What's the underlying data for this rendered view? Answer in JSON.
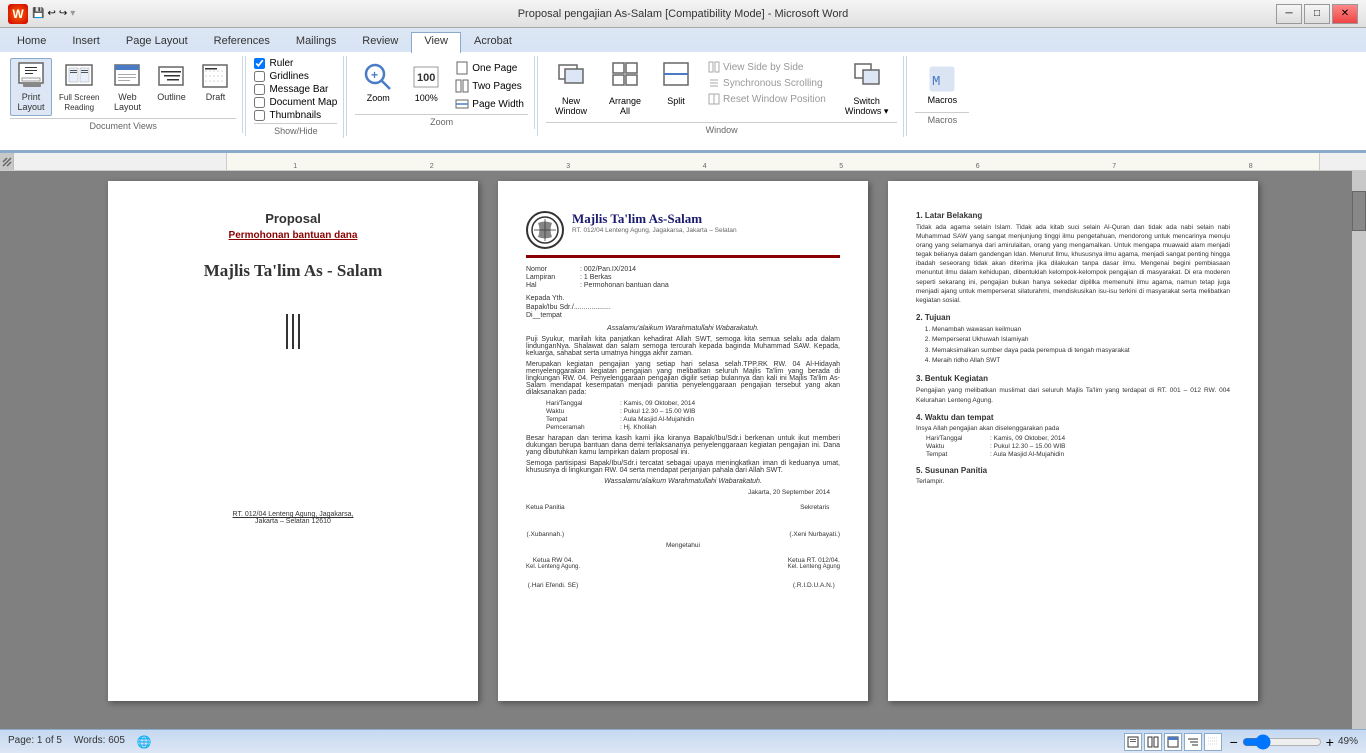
{
  "titleBar": {
    "title": "Proposal pengajian As-Salam [Compatibility Mode] - Microsoft Word",
    "minimizeLabel": "─",
    "maximizeLabel": "□",
    "closeLabel": "✕"
  },
  "ribbon": {
    "tabs": [
      "Home",
      "Insert",
      "Page Layout",
      "References",
      "Mailings",
      "Review",
      "View",
      "Acrobat"
    ],
    "activeTab": "View",
    "groups": {
      "documentViews": {
        "label": "Document Views",
        "buttons": [
          {
            "id": "print-layout",
            "label": "Print Layout",
            "active": true
          },
          {
            "id": "full-screen",
            "label": "Full Screen Reading",
            "active": false
          },
          {
            "id": "web-layout",
            "label": "Web Layout",
            "active": false
          },
          {
            "id": "outline",
            "label": "Outline",
            "active": false
          },
          {
            "id": "draft",
            "label": "Draft",
            "active": false
          }
        ]
      },
      "showHide": {
        "label": "Show/Hide",
        "items": [
          {
            "id": "ruler",
            "label": "Ruler",
            "checked": true
          },
          {
            "id": "gridlines",
            "label": "Gridlines",
            "checked": false
          },
          {
            "id": "message-bar",
            "label": "Message Bar",
            "checked": false
          },
          {
            "id": "document-map",
            "label": "Document Map",
            "checked": false
          },
          {
            "id": "thumbnails",
            "label": "Thumbnails",
            "checked": false
          }
        ]
      },
      "zoom": {
        "label": "Zoom",
        "buttons": [
          "Zoom",
          "100%",
          "One Page",
          "Two Pages",
          "Page Width"
        ],
        "currentZoom": "100%"
      },
      "window": {
        "label": "Window",
        "newWindow": "New Window",
        "arrangeAll": "Arrange All",
        "split": "Split",
        "options": [
          {
            "label": "View Side by Side",
            "disabled": true
          },
          {
            "label": "Synchronous Scrolling",
            "disabled": true
          },
          {
            "label": "Reset Window Position",
            "disabled": true
          }
        ],
        "switchWindows": "Switch Windows"
      },
      "macros": {
        "label": "Macros",
        "button": "Macros"
      }
    }
  },
  "document": {
    "page1": {
      "title": "Proposal",
      "subtitle": "Permohonan bantuan dana",
      "orgName": "Majlis Ta'lim As - Salam",
      "address1": "RT. 012/04 Lenteng  Agung, Jagakarsa,",
      "address2": "Jakarta – Selatan 12610"
    },
    "page2": {
      "orgName": "Majlis Ta'lim  As-Salam",
      "orgAddress": "RT. 012/04 Lenteng  Agung, Jagakarsa, Jakarta – Selatan",
      "nomorLabel": "Nomor",
      "nomorValue": ": 002/Pan.IX/2014",
      "lampiranLabel": "Lampiran",
      "lampiranValue": ": 1 Berkas",
      "halLabel": "Hal",
      "halValue": ": Permohonan bantuan dana",
      "kepadaLabel": "Kepada Yth.",
      "kepadaValue": "Bapak/Ibu Sdr./...................",
      "diLabel": "Di__tempat",
      "greeting": "Assalamu'alaikum Warahmatullahi Wabarakatuh.",
      "body1": "Puji Syukur, marilah kita panjatkan kehadirat Allah SWT, semoga kita semua selalu ada dalam lindunganNya. Shalawat dan salam semoga tercurah kepada baginda Muhammad SAW. Kepada, keluarga, sahabat serta umatnya hingga akhir zaman.",
      "body2": "Merupakan kegiatan pengajian yang setiap hari selasa selah.TPP.RK RW. 04 Al-Hidayah menyelenggarakan kegiatan pengajian yang melibatkan seluruh Majlis Ta'lim yang berada di lingkungan RW. 04. Penyelenggaraan pengajian digilir setiap bulannya dan kali ini Majlis Ta'lim As-Salam mendapat kesempatan menjadi panitia penyelenggaraan pengajian tersebut yang akan dilaksanakan pada:",
      "hariLabel": "Hari/Tanggal",
      "hariValue": ": Kamis, 09 Oktober, 2014",
      "waktuLabel": "Waktu",
      "waktuValue": ": Pukul 12.30 – 15.00 WIB",
      "tempatLabel": "Tempat",
      "tempatValue": ": Aula Masjid Al-Mujahidin",
      "pemceramahLabel": "Pemceramah",
      "pemceramahValue": ": Hj. Kholilah",
      "body3": "Besar harapan dan terima kasih kami jika kiranya Bapak/Ibu/Sdr.i berkenan untuk ikut memberi dukungan berupa bantuan dana demi terlaksananya penyelenggaraan kegiatan pengajian ini. Dana yang dibutuhkan kamu lampirkan dalam proposal ini.",
      "body4": "Semoga partisipasi Bapak/Ibu/Sdr.i tercatat sebagai upaya meningkatkan iman di keduanya umat, khususnya di lingkungan RW. 04 serta mendapat perjanjian pahala dari Allah SWT.",
      "closing": "Wassalamu'alaikum Warahmatullahi Wabarakatuh.",
      "city": "Jakarta, 20 September 2014",
      "ketuaLabel": "Ketua Panitia",
      "sekretarisLabel": "Sekretaris",
      "mengetahuiLabel": "Mengetahui",
      "name1": "(.Xubannah.)",
      "name2": "(.Xeni Nurbayati.)",
      "ketuaRWLabel": "Ketua RW 04.",
      "ketuaRW2Label": "Ketua RT. 012/04.",
      "kelLabel": "Kel. Lenteng Agung.",
      "kel2Label": "Kel. Lenteng Agung",
      "name3": "(.Hari Efendi. SE)",
      "name4": "(.R.I.D.U.A.N.)"
    },
    "page3": {
      "sections": [
        {
          "num": "1.",
          "title": "Latar Belakang",
          "content": "Tidak ada agama selain Islam. Tidak ada kitab suci selain Al-Quran dan tidak ada nabi selain nabi Muhammad SAW yang sangat menjunjung tinggi ilmu pengetahuan, mendorong untuk mencarinya menuju orang yang selamanya dari amirulaitan, orang yang mengamalkan. Untuk mengapa muawaid alam menjadi tegak belianya dalam gandengan Idan. Menurut Ilmu, khususnya ilmu agama, menjadi sangat penting hingga ibadah seseorang tidak akan diterima jika dilakukan tanpa dasar ilmu. Mengenai begini pembiasaan menuntut ilmu dalam kehidupan, dibentuklah kelompok-kelompok pengajian di masyarakat. Di era moderen seperti sekarang ini, pengajian bukan hanya sekedar dipillka memenuhi ilmu agama, namun tetap juga menjadi ajang untuk memperserat silaturahmi, mendiskusikan isu-isu terkini di masyarakat serta melibatkan kegiatan sosial."
        },
        {
          "num": "2.",
          "title": "Tujuan",
          "items": [
            "Menambah wawasan keilmuan",
            "Memperserat Ukhuwah Islamiyah",
            "Memaksimalkan sumber daya pada perempua di tengah masyarakat",
            "Meraih ridho Allah SWT"
          ]
        },
        {
          "num": "3.",
          "title": "Bentuk Kegiatan",
          "content": "Pengajian yang melibatkan muslimat dari seluruh Majlis Ta'lim yang terdapat di RT. 001 – 012 RW. 004 Kelurahan Lenteng Agung."
        },
        {
          "num": "4.",
          "title": "Waktu dan tempat",
          "content": "Insya Allah pengajian akan diselenggarakan pada",
          "hariLabel": "Hari/Tanggal",
          "hariValue": ": Kamis, 09 Oktober, 2014",
          "waktuLabel": "Waktu",
          "waktuValue": ": Pukul 12.30 – 15.00 WIB",
          "tempatLabel": "Tempat",
          "tempatValue": ": Aula Masjid Al-Mujahidin"
        },
        {
          "num": "5.",
          "title": "Susunan Panitia",
          "content": "Terlampir."
        }
      ]
    }
  },
  "statusBar": {
    "page": "Page: 1 of 5",
    "words": "Words: 605",
    "zoom": "49%"
  }
}
